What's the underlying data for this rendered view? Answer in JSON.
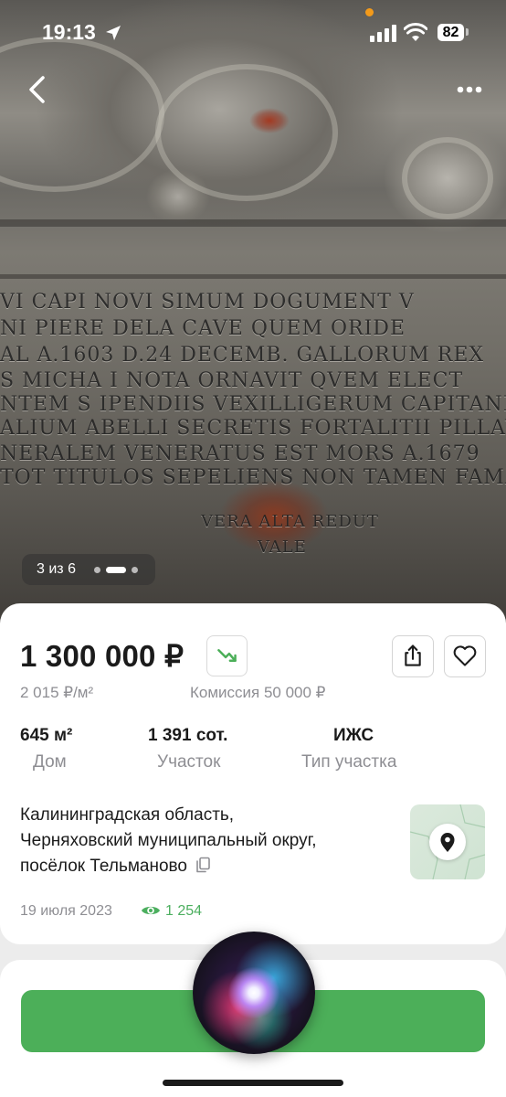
{
  "status_bar": {
    "time": "19:13",
    "battery": "82"
  },
  "nav": {
    "back_icon": "chevron-left-icon",
    "more_icon": "ellipsis-icon"
  },
  "gallery": {
    "counter": "3 из 6",
    "current_index": 3,
    "total": 6,
    "inscription_lines": [
      "VI CAPI NOVI SIMUM DOGUMENT V",
      "NI PIERE DELA CAVE QUEM ORIDE",
      "AL A.1603 D.24 DECEMB. GALLORUM REX",
      "S MICHA I NOTA ORNAVIT QVEM ELECT",
      "NTEM S IPENDIIS VEXILLIGERUM CAPITANE",
      "ALIUM ABELLI SECRETIS FORTALITII PILLAV",
      "NERALEM VENERATUS EST MORS A.1679",
      "TOT TITULOS SEPELIENS NON TAMEN FAMA",
      "VERA ALTA REDUT",
      "VALE"
    ]
  },
  "listing": {
    "price": "1 300 000 ₽",
    "price_per_m2": "2 015 ₽/м²",
    "commission": "Комиссия 50 000 ₽",
    "stats": [
      {
        "value": "645 м²",
        "label": "Дом"
      },
      {
        "value": "1 391 сот.",
        "label": "Участок"
      },
      {
        "value": "ИЖС",
        "label": "Тип участка"
      }
    ],
    "address_lines": [
      "Калининградская область,",
      "Черняховский муниципальный округ,",
      "посёлок Тельманово"
    ],
    "date": "19 июля 2023",
    "views": "1 254"
  },
  "colors": {
    "accent_green": "#4caf59",
    "text_gray": "#8e8e93"
  }
}
